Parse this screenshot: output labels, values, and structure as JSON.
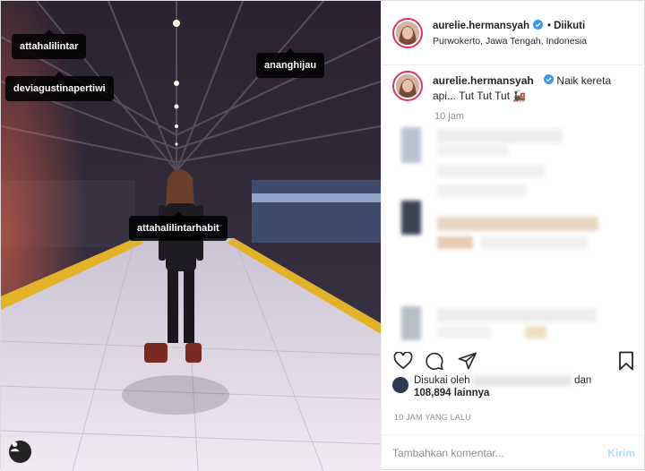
{
  "post": {
    "username": "aurelie.hermansyah",
    "follow_status": "Diikuti",
    "location": "Purwokerto, Jawa Tengah, Indonesia"
  },
  "caption": {
    "username": "aurelie.hermansyah",
    "text": "Naik kereta api... Tut Tut Tut 🚂",
    "time": "10 jam"
  },
  "photo_tags": [
    "attahalilintar",
    "deviagustinapertiwi",
    "ananghijau",
    "attahalilintarhabit"
  ],
  "icons": [
    "verified-badge-icon",
    "heart-icon",
    "comment-icon",
    "share-icon",
    "bookmark-icon",
    "user-tag-icon"
  ],
  "likes": {
    "prefix": "Disukai oleh",
    "and": "dan",
    "count": "108,894",
    "suffix": "lainnya"
  },
  "timestamp": "10 JAM YANG LALU",
  "comment_box": {
    "placeholder": "Tambahkan komentar...",
    "post_label": "Kirim"
  },
  "colors": {
    "accent": "#0095f6",
    "verified": "#3897f0",
    "muted": "#8e8e8e",
    "post_disabled": "#b3dbff"
  }
}
